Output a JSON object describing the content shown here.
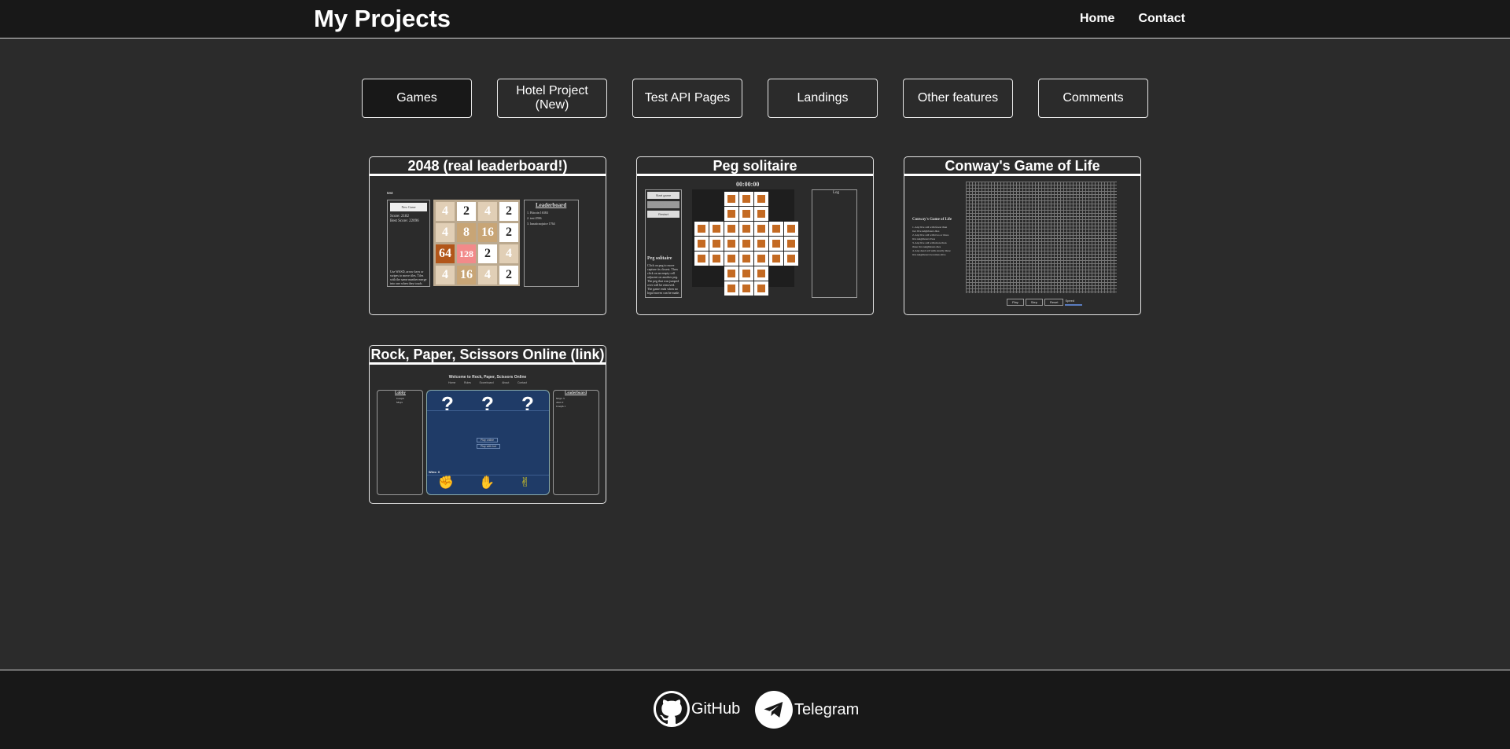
{
  "header": {
    "title": "My Projects",
    "nav": [
      "Home",
      "Contact"
    ]
  },
  "tabs": [
    {
      "label": "Games",
      "active": true
    },
    {
      "label": "Hotel Project (New)",
      "active": false
    },
    {
      "label": "Test API Pages",
      "active": false
    },
    {
      "label": "Landings",
      "active": false
    },
    {
      "label": "Other features",
      "active": false
    },
    {
      "label": "Comments",
      "active": false
    }
  ],
  "projects": [
    {
      "title": "2048 (real leaderboard!)",
      "preview": {
        "user": "test",
        "new_game": "New Game",
        "score": "Score: 2182",
        "best_score": "Best Score: 22096",
        "leaderboard_title": "Leaderboard",
        "leaderboard": [
          "1. Bitcoin  16384",
          "2. test  2596",
          "3. lunaticnojuice  1764"
        ],
        "help": "Use WASD, arrow keys or swipes to move tiles. Tiles with the same number merge into one when they touch. Add them up to reach 2048",
        "tiles": [
          "4",
          "2",
          "4",
          "2",
          "4",
          "8",
          "16",
          "2",
          "64",
          "128",
          "2",
          "4",
          "4",
          "16",
          "4",
          "2"
        ]
      }
    },
    {
      "title": "Peg solitaire",
      "preview": {
        "timer": "00:00:00",
        "buttons": [
          "Start game",
          "Undo",
          "Restart"
        ],
        "heading": "Peg solitaire",
        "help": "Click on peg to move capture its closest. Then click on an empty cell adjacent on another peg. The peg that was jumped over will be removed. The game ends when no legal moves can be made.",
        "log_title": "Log"
      }
    },
    {
      "title": "Conway's Game of Life",
      "preview": {
        "heading": "Conway's Game of Life",
        "rules": [
          "1. Any live cell with fewer than two live neighbours dies",
          "2. Any live cell with two or three live neighbours lives",
          "3. Any live cell with more than three live neighbours dies",
          "4. Any dead cell with exactly three live neighbours becomes alive"
        ],
        "controls": [
          "Play",
          "Step",
          "Reset",
          "Speed"
        ]
      }
    },
    {
      "title": "Rock, Paper, Scissors Online (link)",
      "preview": {
        "welcome": "Welcome to Rock, Paper, Scissors Online",
        "menu": [
          "Home",
          "Rules",
          "Scoreboard",
          "About",
          "Contact"
        ],
        "lobby_title": "Lobby",
        "lobby": [
          "Joseph",
          "Maya"
        ],
        "leaderboard_title": "Leaderboard",
        "leaderboard": [
          "Maya  3",
          "Alex  2",
          "Joseph  1"
        ],
        "question": "?",
        "buttons": [
          "Play online",
          "Play with bot"
        ],
        "wins": "Wins: 0",
        "hands": [
          "✊",
          "✋",
          "✌"
        ]
      }
    }
  ],
  "footer": {
    "links": [
      "GitHub",
      "Telegram"
    ]
  }
}
